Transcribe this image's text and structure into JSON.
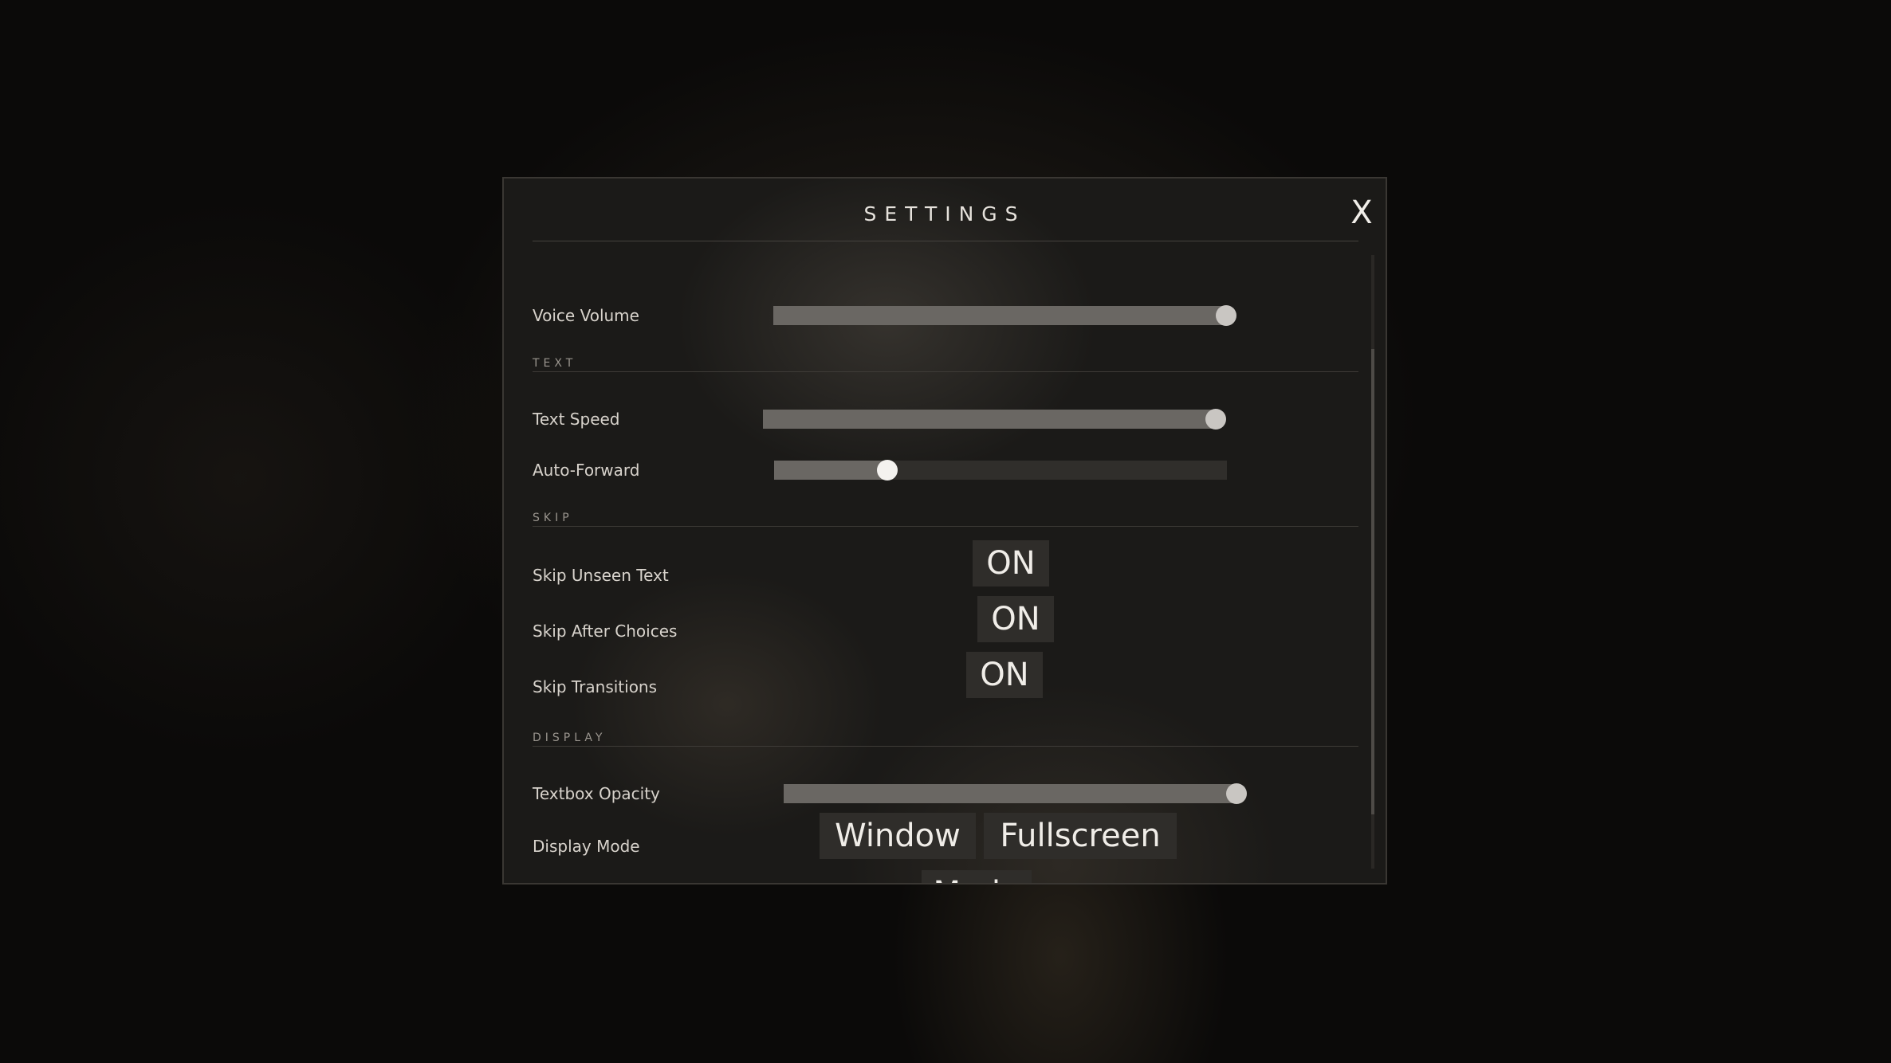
{
  "dialog": {
    "title": "SETTINGS",
    "close_label": "X"
  },
  "settings": {
    "voice_volume": {
      "label": "Voice Volume",
      "value": 1.0
    },
    "text_section": "TEXT",
    "text_speed": {
      "label": "Text Speed",
      "value": 1.0
    },
    "auto_forward": {
      "label": "Auto-Forward",
      "value": 0.25
    },
    "skip_section": "SKIP",
    "skip_unseen": {
      "label": "Skip Unseen Text",
      "state": "ON"
    },
    "skip_after_choices": {
      "label": "Skip After Choices",
      "state": "ON"
    },
    "skip_transitions": {
      "label": "Skip Transitions",
      "state": "ON"
    },
    "display_section": "DISPLAY",
    "textbox_opacity": {
      "label": "Textbox Opacity",
      "value": 1.0
    },
    "display_mode": {
      "label": "Display Mode",
      "options": [
        "Window",
        "Fullscreen",
        "Mode"
      ]
    }
  },
  "colors": {
    "panel_bg": "#1b1a18",
    "slider_track": "#302e2b",
    "slider_fill": "#6a6763",
    "thumb": "#c9c6c2",
    "button_bg": "#2f2d2a",
    "text": "#d8d3cc"
  }
}
